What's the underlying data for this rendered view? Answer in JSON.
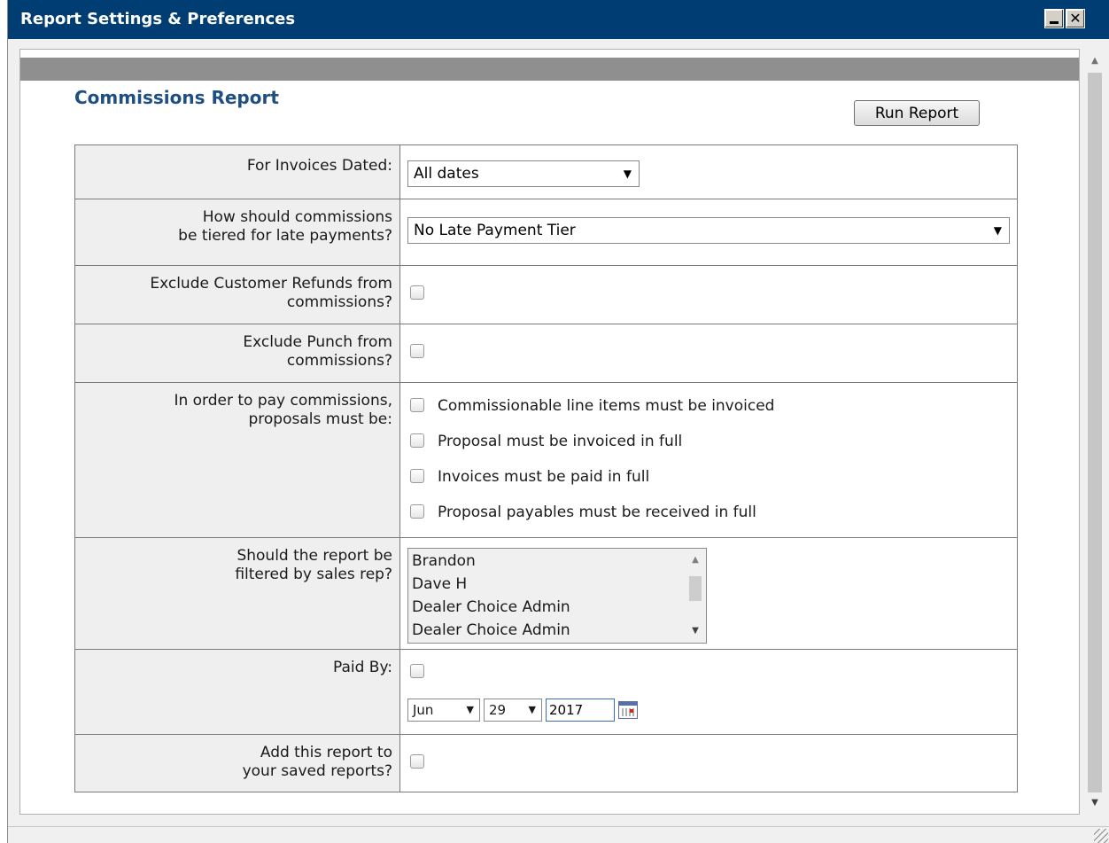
{
  "window": {
    "title": "Report Settings & Preferences"
  },
  "report": {
    "title": "Commissions Report",
    "run_button": "Run Report"
  },
  "fields": {
    "invoices_dated": {
      "label": "For Invoices Dated:",
      "value": "All dates"
    },
    "late_tier": {
      "label_line1": "How should commissions",
      "label_line2": "be tiered for late payments?",
      "value": "No Late Payment Tier"
    },
    "exclude_refunds": {
      "label_line1": "Exclude Customer Refunds from",
      "label_line2": "commissions?",
      "checked": false
    },
    "exclude_punch": {
      "label_line1": "Exclude Punch from",
      "label_line2": "commissions?",
      "checked": false
    },
    "pay_conditions": {
      "label_line1": "In order to pay commissions,",
      "label_line2": "proposals must be:",
      "options": [
        {
          "label": "Commissionable line items must be invoiced",
          "checked": false
        },
        {
          "label": "Proposal must be invoiced in full",
          "checked": false
        },
        {
          "label": "Invoices must be paid in full",
          "checked": false
        },
        {
          "label": "Proposal payables must be received in full",
          "checked": false
        }
      ]
    },
    "sales_rep": {
      "label_line1": "Should the report be",
      "label_line2": "filtered by sales rep?",
      "items": [
        "Brandon",
        "Dave H",
        "Dealer Choice Admin",
        "Dealer Choice Admin"
      ]
    },
    "paid_by": {
      "label": "Paid By:",
      "checked": false,
      "month": "Jun",
      "day": "29",
      "year": "2017"
    },
    "save_report": {
      "label_line1": "Add this report to",
      "label_line2": "your saved reports?",
      "checked": false
    }
  }
}
